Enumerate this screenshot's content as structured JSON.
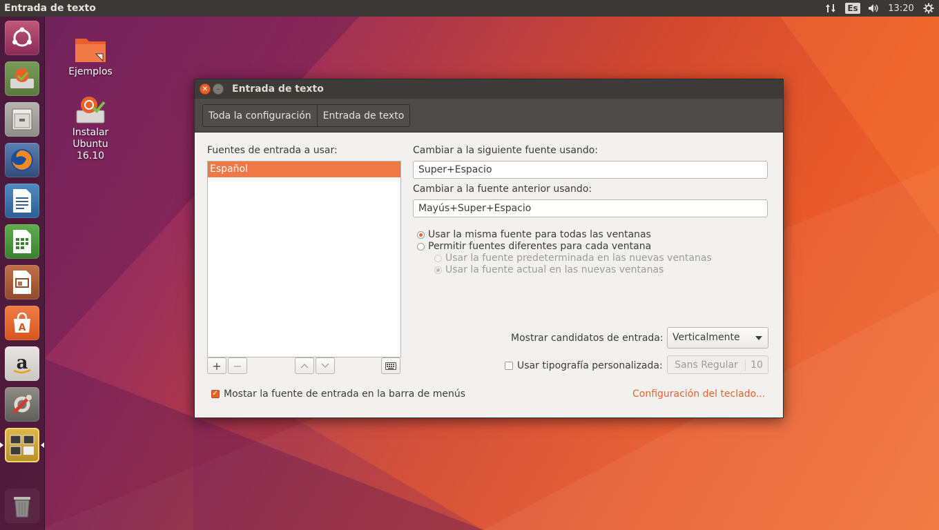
{
  "top_panel": {
    "title": "Entrada de texto",
    "keyboard_indicator": "Es",
    "clock": "13:20"
  },
  "launcher": {
    "items": [
      "ubuntu-dash",
      "install-ubuntu",
      "files",
      "firefox",
      "libreoffice-writer",
      "libreoffice-calc",
      "libreoffice-impress",
      "ubuntu-software",
      "amazon",
      "system-settings",
      "workspace-switcher",
      "trash"
    ]
  },
  "desktop": {
    "icons": [
      {
        "label": "Ejemplos"
      },
      {
        "label": "Instalar Ubuntu 16.10"
      }
    ]
  },
  "window": {
    "title": "Entrada de texto",
    "breadcrumbs": [
      "Toda la configuración",
      "Entrada de texto"
    ],
    "sources_label": "Fuentes de entrada a usar:",
    "sources": [
      "Español"
    ],
    "next_source_label": "Cambiar a la siguiente fuente usando:",
    "next_source_value": "Super+Espacio",
    "prev_source_label": "Cambiar a la fuente anterior usando:",
    "prev_source_value": "Mayús+Super+Espacio",
    "options": {
      "same_source": "Usar la misma fuente para todas las ventanas",
      "different_source": "Permitir fuentes diferentes para cada ventana",
      "default_source": "Usar la fuente predeterminada en las nuevas ventanas",
      "current_source": "Usar la fuente actual en las nuevas ventanas"
    },
    "candidates_label": "Mostrar candidatos de entrada:",
    "candidates_value": "Verticalmente",
    "custom_font_label": "Usar tipografía personalizada:",
    "font_name": "Sans Regular",
    "font_size": "10",
    "show_in_menubar_label": "Mostar la fuente de entrada en la barra de menús",
    "keyboard_settings_link": "Configuración del teclado...",
    "colors": {
      "accent": "#e8602c",
      "selection": "#f07746"
    }
  }
}
